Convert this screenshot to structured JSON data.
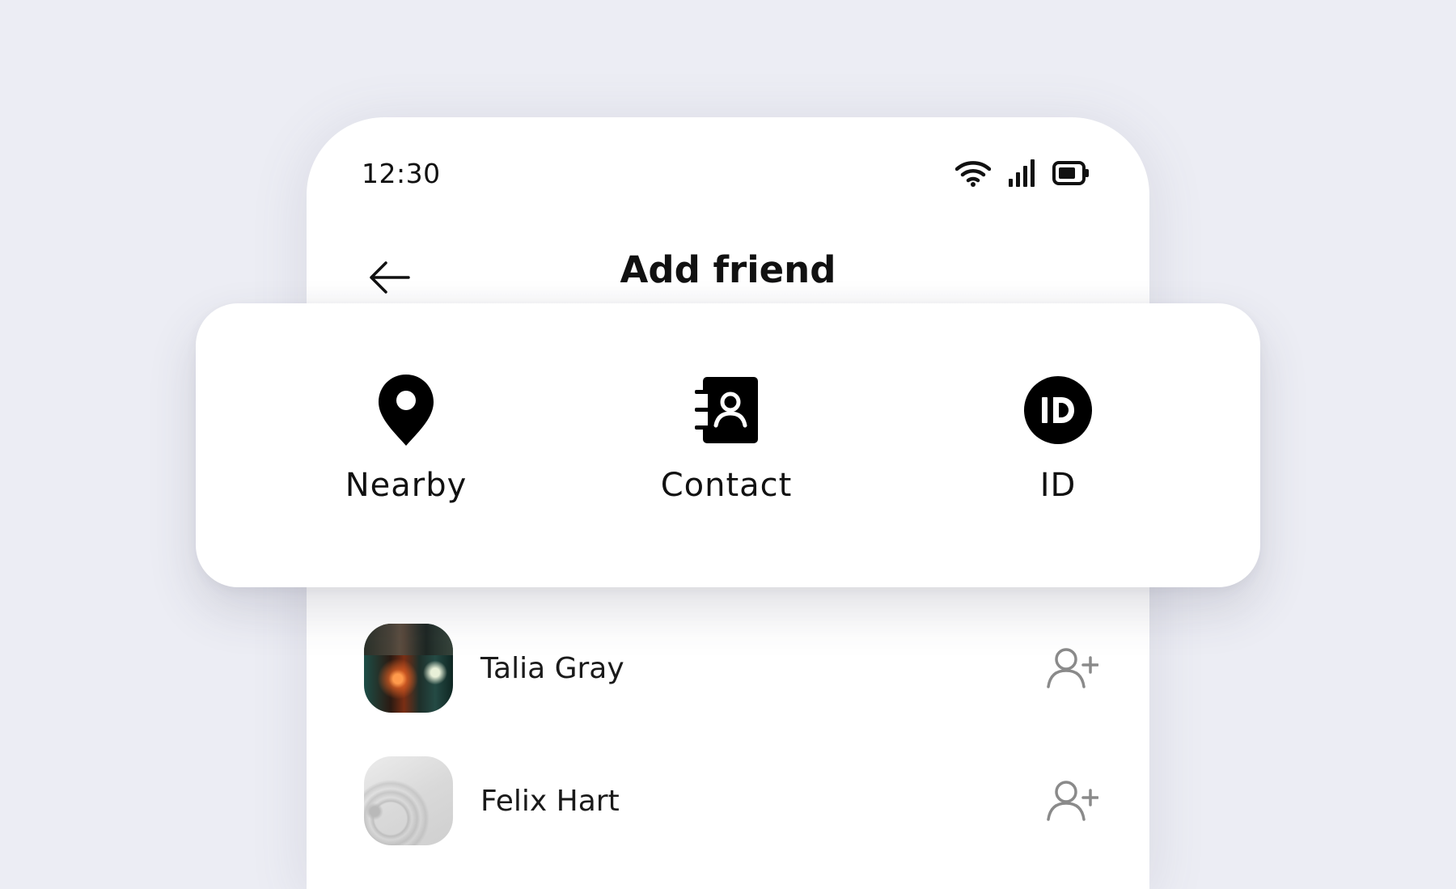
{
  "status_bar": {
    "time": "12:30",
    "icons": [
      "wifi-icon",
      "cellular-signal-icon",
      "battery-icon"
    ]
  },
  "header": {
    "title": "Add friend",
    "back_icon": "arrow-left-icon"
  },
  "actions": [
    {
      "label": "Nearby",
      "icon": "location-pin-icon"
    },
    {
      "label": "Contact",
      "icon": "contact-book-icon"
    },
    {
      "label": "ID",
      "icon": "id-badge-icon"
    }
  ],
  "people": [
    {
      "name": "Talia Gray",
      "action_icon": "add-user-icon"
    },
    {
      "name": "Felix Hart",
      "action_icon": "add-user-icon"
    }
  ],
  "colors": {
    "background": "#ecedf4",
    "surface": "#ffffff",
    "text": "#111111",
    "icon_muted": "#8a8a8a"
  }
}
